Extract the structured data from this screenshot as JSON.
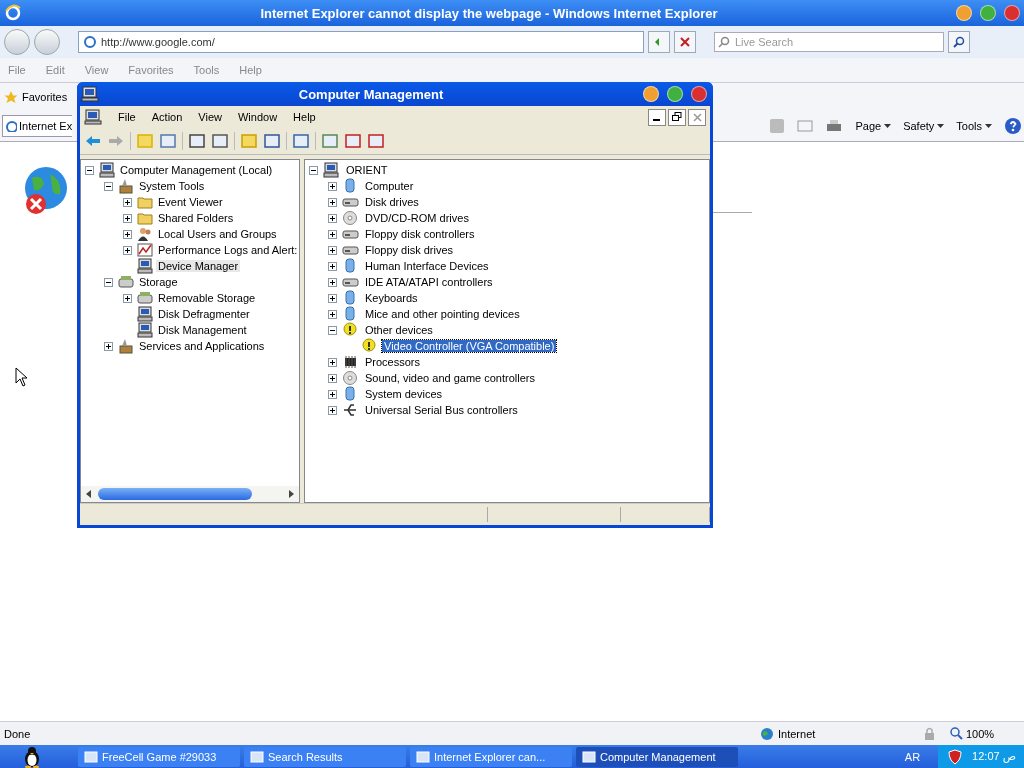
{
  "ie": {
    "title": "Internet Explorer cannot display the webpage - Windows Internet Explorer",
    "address": "http://www.google.com/",
    "search": {
      "placeholder": "Live Search"
    },
    "menu": [
      "File",
      "Edit",
      "View",
      "Favorites",
      "Tools",
      "Help"
    ],
    "favorites": "Favorites",
    "tab": "Internet Ex",
    "commands": [
      "Page",
      "Safety",
      "Tools"
    ]
  },
  "cm": {
    "title": "Computer Management",
    "menu": [
      "File",
      "Action",
      "View",
      "Window",
      "Help"
    ],
    "left_tree": [
      {
        "label": "Computer Management (Local)",
        "kind": "computer",
        "expanded": true,
        "selected": false,
        "children": [
          {
            "label": "System Tools",
            "kind": "tools",
            "expanded": true,
            "selected": false,
            "children": [
              {
                "label": "Event Viewer",
                "kind": "folder",
                "expanded": false,
                "selected": false
              },
              {
                "label": "Shared Folders",
                "kind": "folder",
                "expanded": false,
                "selected": false
              },
              {
                "label": "Local Users and Groups",
                "kind": "users",
                "expanded": false,
                "selected": false
              },
              {
                "label": "Performance Logs and Alert:",
                "kind": "chart",
                "expanded": false,
                "selected": false
              },
              {
                "label": "Device Manager",
                "kind": "leaf",
                "selected": true
              }
            ]
          },
          {
            "label": "Storage",
            "kind": "drive",
            "expanded": true,
            "selected": false,
            "children": [
              {
                "label": "Removable Storage",
                "kind": "drive",
                "expanded": false,
                "selected": false
              },
              {
                "label": "Disk Defragmenter",
                "kind": "leaf",
                "selected": false
              },
              {
                "label": "Disk Management",
                "kind": "leaf",
                "selected": false
              }
            ]
          },
          {
            "label": "Services and Applications",
            "kind": "tools",
            "expanded": false,
            "selected": false
          }
        ]
      }
    ],
    "right_tree": [
      {
        "label": "ORIENT",
        "kind": "computer",
        "expanded": true,
        "selected": false,
        "children": [
          {
            "label": "Computer",
            "kind": "device",
            "expanded": false,
            "selected": false
          },
          {
            "label": "Disk drives",
            "kind": "drive",
            "expanded": false,
            "selected": false
          },
          {
            "label": "DVD/CD-ROM drives",
            "kind": "disc",
            "expanded": false,
            "selected": false
          },
          {
            "label": "Floppy disk controllers",
            "kind": "drive",
            "expanded": false,
            "selected": false
          },
          {
            "label": "Floppy disk drives",
            "kind": "drive",
            "expanded": false,
            "selected": false
          },
          {
            "label": "Human Interface Devices",
            "kind": "device",
            "expanded": false,
            "selected": false
          },
          {
            "label": "IDE ATA/ATAPI controllers",
            "kind": "drive",
            "expanded": false,
            "selected": false
          },
          {
            "label": "Keyboards",
            "kind": "device",
            "expanded": false,
            "selected": false
          },
          {
            "label": "Mice and other pointing devices",
            "kind": "device",
            "expanded": false,
            "selected": false
          },
          {
            "label": "Other devices",
            "kind": "unknown",
            "expanded": true,
            "selected": false,
            "children": [
              {
                "label": "Video Controller (VGA Compatible)",
                "kind": "warning",
                "selected": true
              }
            ]
          },
          {
            "label": "Processors",
            "kind": "chip",
            "expanded": false,
            "selected": false
          },
          {
            "label": "Sound, video and game controllers",
            "kind": "disc",
            "expanded": false,
            "selected": false
          },
          {
            "label": "System devices",
            "kind": "device",
            "expanded": false,
            "selected": false
          },
          {
            "label": "Universal Serial Bus controllers",
            "kind": "usb",
            "expanded": false,
            "selected": false
          }
        ]
      }
    ]
  },
  "status_bar": {
    "text": "Done",
    "zone": "Internet",
    "zoom": "100%"
  },
  "taskbar": {
    "items": [
      {
        "label": "FreeCell Game #29033",
        "selected": false
      },
      {
        "label": "Search Results",
        "selected": false
      },
      {
        "label": "Internet Explorer can...",
        "selected": false
      },
      {
        "label": "Computer Management",
        "selected": true
      }
    ],
    "language": "AR",
    "clock": "12:07 ص"
  }
}
